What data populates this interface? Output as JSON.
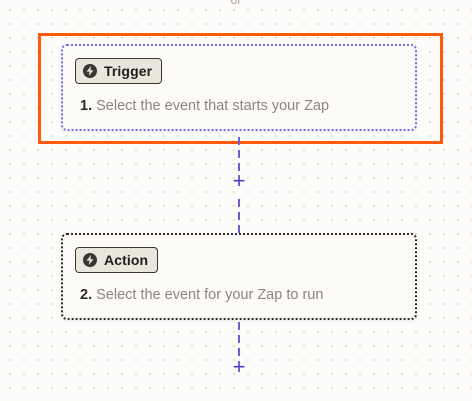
{
  "top_hint": "or",
  "trigger_step": {
    "badge_label": "Trigger",
    "badge_icon": "lightning-icon",
    "number": "1.",
    "description": "Select the event that starts your Zap"
  },
  "action_step": {
    "badge_label": "Action",
    "badge_icon": "lightning-icon",
    "number": "2.",
    "description": "Select the event for your Zap to run"
  },
  "add_step_symbol": "+",
  "colors": {
    "highlight": "#ff5a0a",
    "trigger_border": "#7b68e8",
    "connector": "#6a5fd8",
    "plus": "#4d40c8"
  }
}
